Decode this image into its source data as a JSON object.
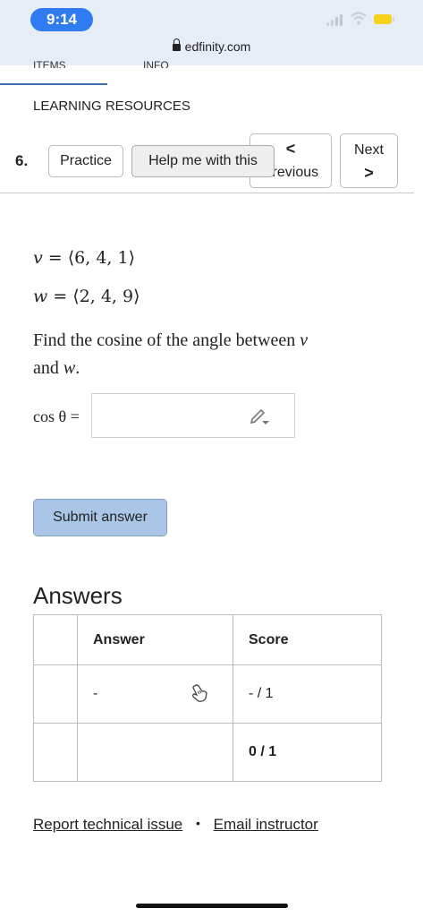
{
  "status_bar": {
    "time": "9:14"
  },
  "browser": {
    "url": "edfinity.com"
  },
  "tabs_cut": {
    "left": "ITEMS",
    "middle": "INFO"
  },
  "section_label": "LEARNING RESOURCES",
  "question": {
    "number": "6.",
    "buttons": {
      "practice": "Practice",
      "help": "Help me with this",
      "previous": "Previous",
      "previous_chevron": "<",
      "next": "Next",
      "next_chevron": ">"
    },
    "v_def": "⟨6, 4, 1⟩",
    "w_def": "⟨2, 4, 9⟩",
    "prompt_before": "Find the cosine of the angle between ",
    "prompt_var1": "v",
    "prompt_mid": " and ",
    "prompt_var2": "w",
    "prompt_end": ".",
    "input_label": "cos θ =",
    "input_value": "",
    "submit_label": "Submit answer"
  },
  "answers": {
    "title": "Answers",
    "headers": [
      "",
      "Answer",
      "Score"
    ],
    "rows": [
      {
        "answer": "-",
        "score": "- / 1"
      },
      {
        "answer": "",
        "score": "0 / 1"
      }
    ]
  },
  "footer": {
    "report": "Report technical issue",
    "separator": "•",
    "email": "Email instructor"
  },
  "colors": {
    "time_pill": "#2f7bf0",
    "submit_bg": "#a9c6e6",
    "battery": "#f6d21b",
    "tab_underline": "#3a6fb0"
  },
  "icons": [
    "lock-icon",
    "signal-icon",
    "wifi-icon",
    "battery-icon",
    "pencil-icon",
    "hand-pointer-icon"
  ]
}
